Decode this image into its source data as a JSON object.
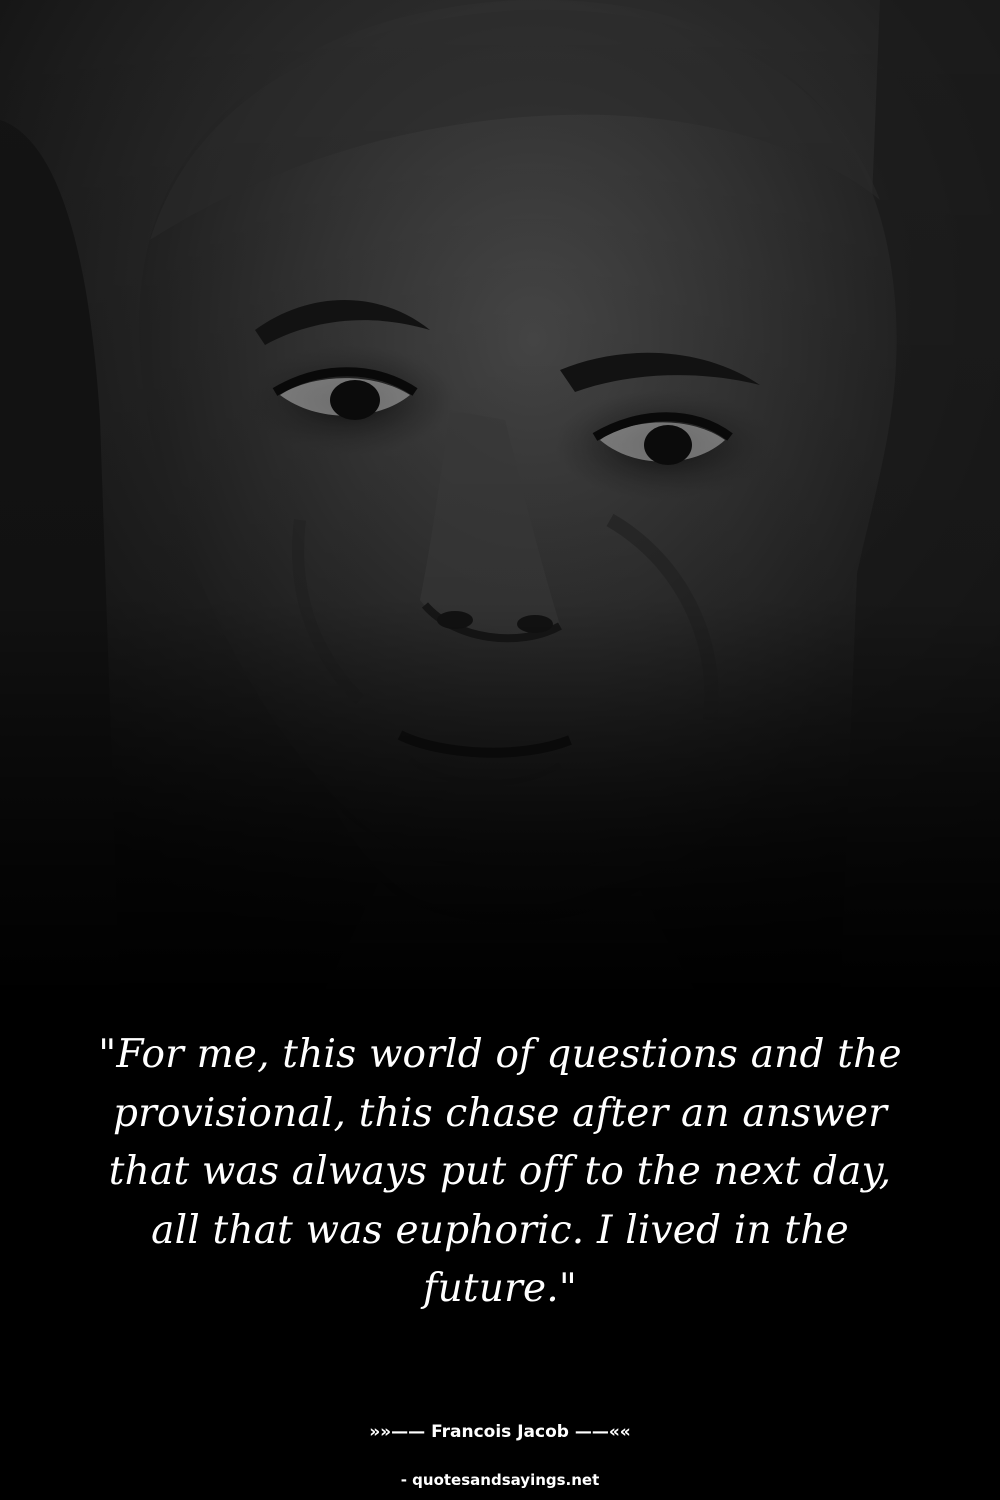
{
  "colors": {
    "background": "#000000",
    "text": "#ffffff",
    "photo_tone": "#2a2a2a"
  },
  "photo": {
    "kind": "grayscale portrait photograph"
  },
  "quote": {
    "lines": [
      "\"For me, this world of questions and the",
      "provisional, this chase after an answer",
      "that was always put off to the next day,",
      "all that was euphoric. I lived in the",
      "future.\""
    ]
  },
  "attribution": {
    "text": "»»—— Francois Jacob ——««"
  },
  "source": {
    "text": "- quotesandsayings.net"
  }
}
